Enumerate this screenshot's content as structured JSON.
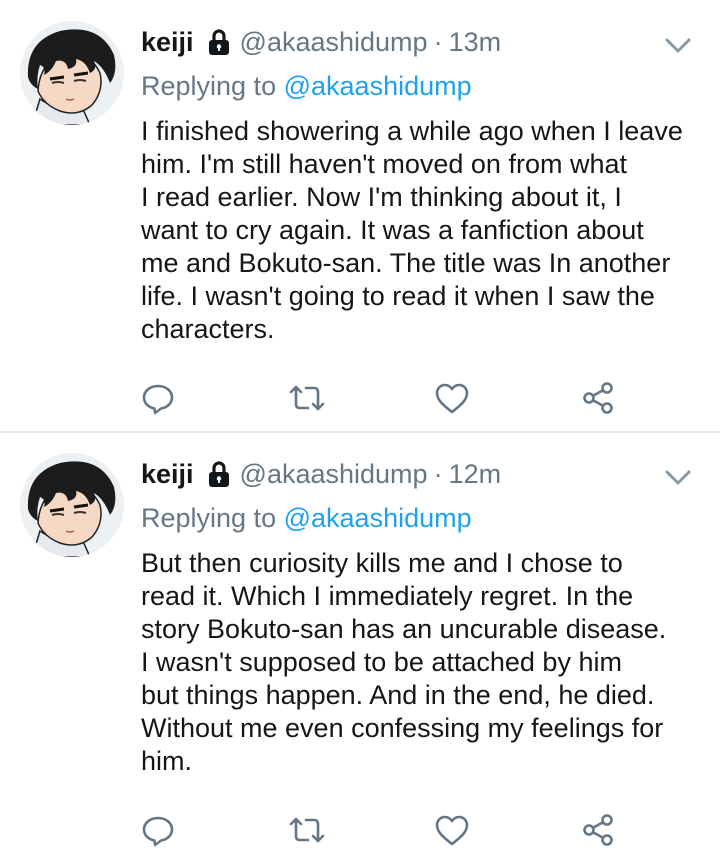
{
  "colors": {
    "handle_gray": "#657786",
    "link_blue": "#1da1f2",
    "text": "#14171a",
    "divider": "#e1e8ed"
  },
  "tweets": [
    {
      "name": "keiji",
      "handle": "@akaashidump",
      "separator": "·",
      "time": "13m",
      "replying_prefix": "Replying to",
      "replying_handle": "@akaashidump",
      "lines": [
        "I finished showering a while ago when I leave",
        "him. I'm still haven't moved on from what",
        "I read earlier. Now I'm thinking about it, I",
        "want to cry again. It was a fanfiction about",
        "me and Bokuto-san. The title was In another",
        "life. I wasn't going to read it when I saw the",
        "characters."
      ],
      "icons": [
        "lock-icon",
        "chevron-down-icon",
        "reply-icon",
        "retweet-icon",
        "like-icon",
        "share-icon"
      ]
    },
    {
      "name": "keiji",
      "handle": "@akaashidump",
      "separator": "·",
      "time": "12m",
      "replying_prefix": "Replying to",
      "replying_handle": "@akaashidump",
      "lines": [
        "But then curiosity kills me and I chose to",
        "read it. Which I immediately regret. In the",
        "story Bokuto-san has an uncurable disease.",
        "I wasn't supposed to be attached by him",
        "but things happen. And in the end, he died.",
        "Without me even confessing my feelings for",
        "him."
      ],
      "icons": [
        "lock-icon",
        "chevron-down-icon",
        "reply-icon",
        "retweet-icon",
        "like-icon",
        "share-icon"
      ]
    }
  ]
}
